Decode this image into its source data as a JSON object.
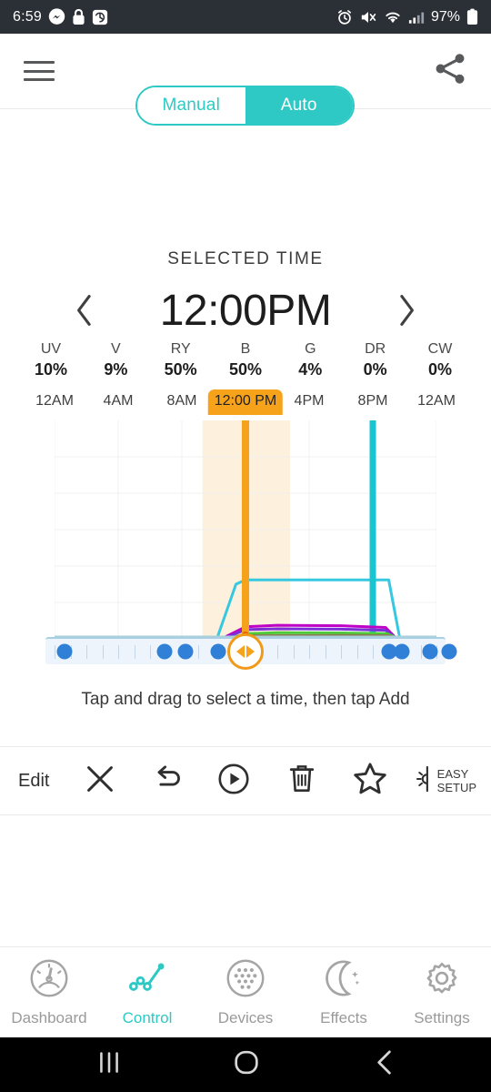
{
  "status_bar": {
    "time": "6:59",
    "battery_text": "97%",
    "left_icons": [
      "messenger-icon",
      "lock-icon",
      "clock-rotate-icon"
    ],
    "right_icons": [
      "alarm-icon",
      "mute-icon",
      "wifi-icon",
      "cell-signal-icon",
      "battery-icon"
    ]
  },
  "header": {
    "menu_icon": "hamburger-menu-icon",
    "share_icon": "share-icon",
    "mode_toggle": {
      "options": [
        "Manual",
        "Auto"
      ],
      "selected": "Auto"
    }
  },
  "selected_time": {
    "label": "SELECTED TIME",
    "value": "12:00PM",
    "prev_icon": "chevron-left-icon",
    "next_icon": "chevron-right-icon"
  },
  "channels": [
    {
      "name": "UV",
      "value": "10%"
    },
    {
      "name": "V",
      "value": "9%"
    },
    {
      "name": "RY",
      "value": "50%"
    },
    {
      "name": "B",
      "value": "50%"
    },
    {
      "name": "G",
      "value": "4%"
    },
    {
      "name": "DR",
      "value": "0%"
    },
    {
      "name": "CW",
      "value": "0%"
    }
  ],
  "chart_data": {
    "type": "line",
    "title": "",
    "xlabel": "",
    "ylabel": "",
    "xlim": [
      0,
      24
    ],
    "ylim": [
      0,
      100
    ],
    "grid": true,
    "legend": "none",
    "tick_labels": [
      "12AM",
      "4AM",
      "8AM",
      "12:00 PM",
      "4PM",
      "8PM",
      "12AM"
    ],
    "tick_hours": [
      0,
      4,
      8,
      12,
      16,
      20,
      24
    ],
    "selected_tick_index": 3,
    "selection": {
      "label": "12:00 PM",
      "hour": 12,
      "band_start_hour": 9.3,
      "band_end_hour": 14.8,
      "color": "#f7a21b",
      "band_color": "#fdf0dc"
    },
    "markers": {
      "color": "#2f80d6",
      "hours": [
        0.6,
        6.9,
        8.2,
        10.3,
        21.0,
        21.8,
        23.6,
        24.8
      ]
    },
    "series": [
      {
        "name": "B",
        "color": "#36c8e0",
        "x": [
          0,
          10.2,
          11.4,
          12.0,
          19.7,
          20.2,
          21.0,
          21.7,
          24
        ],
        "y": [
          0,
          0,
          25,
          27,
          27,
          27,
          27,
          0,
          0
        ]
      },
      {
        "name": "RY-vertical-marker",
        "color": "#19c6d0",
        "x": [
          20,
          20
        ],
        "y": [
          0,
          100
        ]
      },
      {
        "name": "V",
        "color": "#bf00c7",
        "x": [
          0,
          10.5,
          12.0,
          14.0,
          18.0,
          20.8,
          21.5,
          24
        ],
        "y": [
          0,
          0,
          5.5,
          6.2,
          6.0,
          5.2,
          0,
          0
        ]
      },
      {
        "name": "UV",
        "color": "#7b2fd6",
        "x": [
          0,
          10.6,
          12.0,
          14.0,
          18.0,
          20.8,
          21.5,
          24
        ],
        "y": [
          0,
          0,
          4.2,
          4.6,
          4.4,
          3.9,
          0,
          0
        ]
      },
      {
        "name": "G",
        "color": "#4dc93a",
        "x": [
          0,
          10.8,
          12.2,
          14.0,
          18.0,
          20.9,
          21.6,
          24
        ],
        "y": [
          0,
          0,
          2.4,
          2.8,
          2.7,
          2.4,
          0,
          0
        ]
      },
      {
        "name": "DR",
        "color": "#8a7a50",
        "x": [
          0,
          11.0,
          12.4,
          18.0,
          21.0,
          21.6,
          24
        ],
        "y": [
          0,
          0,
          1.4,
          1.6,
          1.4,
          0,
          0
        ]
      },
      {
        "name": "CW",
        "color": "#a9d0d8",
        "x": [
          0,
          24
        ],
        "y": [
          0.5,
          0.5
        ]
      }
    ]
  },
  "hint": "Tap and drag to select a time, then tap Add",
  "toolbar": {
    "edit_label": "Edit",
    "close_icon": "close-x-icon",
    "undo_icon": "undo-arrow-icon",
    "play_icon": "play-circle-icon",
    "delete_icon": "trash-icon",
    "favorite_icon": "star-icon",
    "easy_setup_icon": "half-sun-icon",
    "easy_setup_line1": "EASY",
    "easy_setup_line2": "SETUP"
  },
  "bottom_nav": {
    "active": "Control",
    "items": [
      {
        "label": "Dashboard",
        "icon": "gauge-icon"
      },
      {
        "label": "Control",
        "icon": "line-chart-icon"
      },
      {
        "label": "Devices",
        "icon": "dotted-circle-icon"
      },
      {
        "label": "Effects",
        "icon": "moon-stars-icon"
      },
      {
        "label": "Settings",
        "icon": "gear-icon"
      }
    ]
  },
  "android_nav": {
    "recents_icon": "recents-icon",
    "home_icon": "home-circle-icon",
    "back_icon": "back-chevron-icon"
  },
  "colors": {
    "accent_teal": "#2ec9c4",
    "accent_orange": "#f7a21b",
    "marker_blue": "#2f80d6",
    "statusbar_bg": "#2b2f36"
  }
}
